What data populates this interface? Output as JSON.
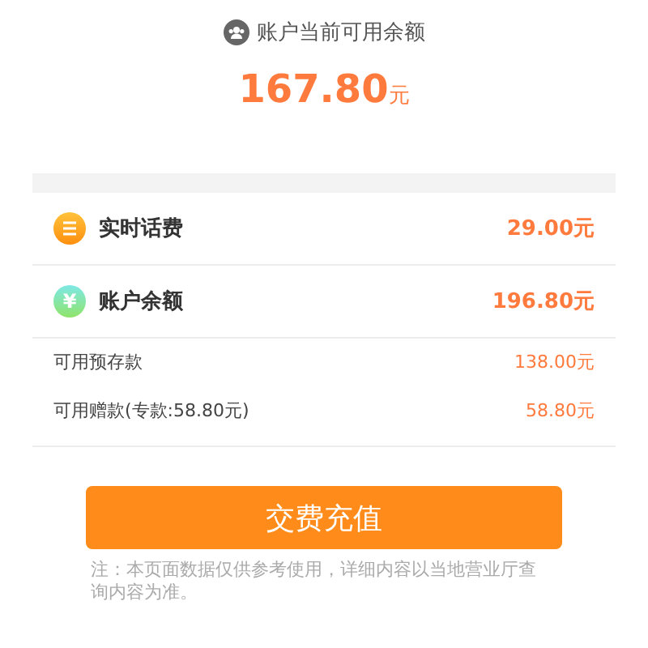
{
  "header": {
    "label": "账户当前可用余额",
    "amount": "167.80",
    "unit": "元"
  },
  "rows": [
    {
      "kind": "main",
      "label": "实时话费",
      "value": "29.00元"
    },
    {
      "kind": "main",
      "label": "账户余额",
      "value": "196.80元",
      "badge": "¥"
    },
    {
      "kind": "sub",
      "label": "可用预存款",
      "value": "138.00元"
    },
    {
      "kind": "sub",
      "label": "可用赠款(专款:58.80元)",
      "value": "58.80元"
    }
  ],
  "button": "交费充值",
  "note": "注：本页面数据仅供参考使用，详细内容以当地营业厅查询内容为准。"
}
